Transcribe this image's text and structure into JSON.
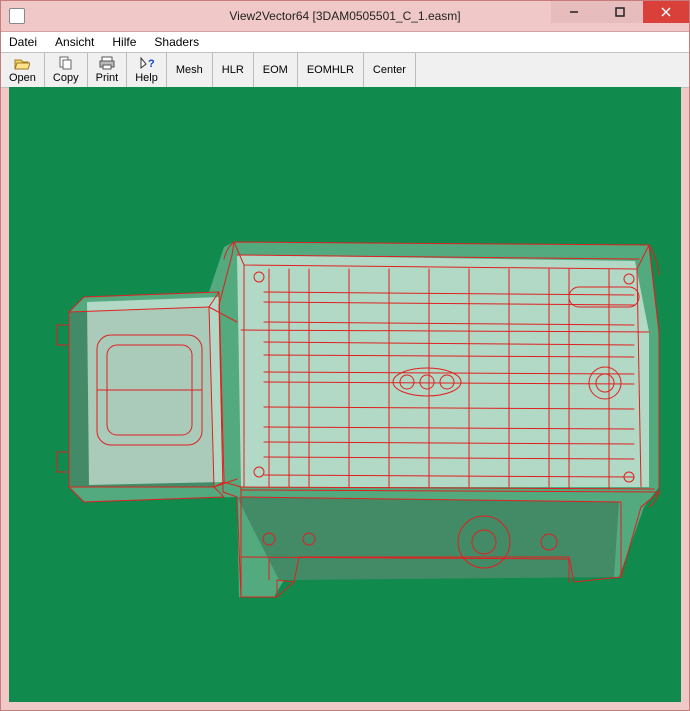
{
  "window": {
    "title": "View2Vector64 [3DAM0505501_C_1.easm]"
  },
  "menu": {
    "items": [
      "Datei",
      "Ansicht",
      "Hilfe",
      "Shaders"
    ]
  },
  "toolbar": {
    "open": "Open",
    "copy": "Copy",
    "print": "Print",
    "help": "Help",
    "mesh": "Mesh",
    "hlr": "HLR",
    "eom": "EOM",
    "eomhlr": "EOMHLR",
    "center": "Center"
  },
  "colors": {
    "viewport_bg": "#108a4d",
    "wire": "#e02020",
    "shade_light": "rgba(255,255,255,0.55)",
    "shade_mid": "rgba(255,255,255,0.30)",
    "shade_dark": "rgba(0,0,0,0.18)"
  }
}
